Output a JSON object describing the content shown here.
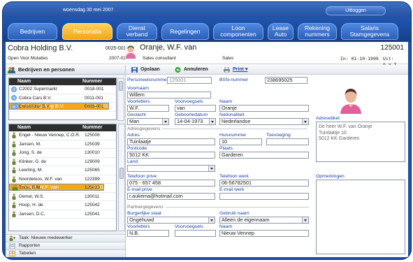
{
  "topbar": {
    "date": "woensdag 30 mei 2007",
    "logout_label": "Uitloggen"
  },
  "tabs": [
    {
      "label": "Bedrijven"
    },
    {
      "label": "Personalia"
    },
    {
      "label": "Dienst verband"
    },
    {
      "label": "Regelingen"
    },
    {
      "label": "Loon componenten"
    },
    {
      "label": "Lease Auto"
    },
    {
      "label": "Rekening nummers"
    },
    {
      "label": "Salaris Stamgegevens"
    }
  ],
  "header": {
    "company": "Cobra Holding B.V.",
    "company_code": "0025-001",
    "company_sub": "Open Voor Mutaties",
    "year": "2007-02",
    "person": "Oranje, W.F. van",
    "role": "Sales consultant",
    "department": "Sales",
    "person_code": "125001",
    "in_date": "In: 01-10-1999",
    "out_date": "Uit: n.v.t."
  },
  "left": {
    "title": "Bedrijven en personen",
    "companies_header": {
      "name": "Naam",
      "number": "Nummer"
    },
    "companies": [
      {
        "name": "C2002 Supermarkt",
        "number": "0018-001"
      },
      {
        "name": "Cobra Cars B.V.",
        "number": "0011-001"
      },
      {
        "name": "Cobra Holding B.V.",
        "number": "0025-001"
      },
      {
        "name": "Constrictor B.V.",
        "number": "0003-001"
      }
    ],
    "persons_header": {
      "name": "Naam",
      "number": "Nummer"
    },
    "persons": [
      {
        "name": "Engel - Nieuw Vennep, C.O.R.",
        "number": "125006"
      },
      {
        "name": "Jansen, M.",
        "number": "125039"
      },
      {
        "name": "Jong, S. de",
        "number": "130010"
      },
      {
        "name": "Klinker, G. de",
        "number": "129009"
      },
      {
        "name": "Leerling, M.",
        "number": "125065"
      },
      {
        "name": "Noordeloos, W.F. van",
        "number": "122399"
      },
      {
        "name": "Oranje, W.F. van",
        "number": "125001"
      },
      {
        "name": "Tsiou, B.M.",
        "number": "125023"
      },
      {
        "name": "Demel, W.S.",
        "number": "130011"
      },
      {
        "name": "Hoop, H. de",
        "number": "125042"
      },
      {
        "name": "Jansen, D.C.",
        "number": "125041"
      }
    ],
    "nav": [
      {
        "label": "Taak: Nieuwe medewerker"
      },
      {
        "label": "Rapporten"
      },
      {
        "label": "Tabellen"
      }
    ]
  },
  "toolbar": {
    "save": "Opslaan",
    "cancel": "Annuleren",
    "print": "Print ▾"
  },
  "form": {
    "personeelsnummer": {
      "label": "Personeelsnummer",
      "value": "125001"
    },
    "bsn": {
      "label": "BSN-nummer",
      "value": "238695025"
    },
    "voornaam": {
      "label": "Voornaam",
      "value": "Willem"
    },
    "voorletters": {
      "label": "Voorletters",
      "value": "W.F."
    },
    "voorvoegsels": {
      "label": "Voorvoegsels",
      "value": "van"
    },
    "naam": {
      "label": "Naam",
      "value": "Oranje"
    },
    "geslacht": {
      "label": "Geslacht",
      "value": "Man"
    },
    "geboortedatum": {
      "label": "Geboortedatum",
      "value": "14-04-1973"
    },
    "nationaliteit": {
      "label": "Nationaliteit",
      "value": "Nederlandse"
    },
    "adresetiket": {
      "label": "Adresetiket",
      "lines": [
        "De heer W.F. van Oranje",
        "Tuinlaatje 10",
        "5012 KK  Garderen"
      ]
    },
    "adres_section": "Adresgegevens",
    "adres": {
      "label": "Adres",
      "value": "Tuinlaatje"
    },
    "huisnummer": {
      "label": "Huisnummer",
      "value": "10"
    },
    "toevoeging": {
      "label": "Toevoeging",
      "value": ""
    },
    "postcode": {
      "label": "Postcode",
      "value": "5012 KK"
    },
    "plaats": {
      "label": "Plaats",
      "value": "Garderen"
    },
    "land": {
      "label": "Land",
      "value": ""
    },
    "tel_prive": {
      "label": "Telefoon prive",
      "value": "075 - 657 458"
    },
    "tel_werk": {
      "label": "Telefoon werk",
      "value": "06-56782501"
    },
    "email_prive": {
      "label": "E-mail prive",
      "value": "r.aukema@hotmail.com"
    },
    "email_werk": {
      "label": "E-mail werk",
      "value": ""
    },
    "opmerkingen": {
      "label": "Opmerkingen"
    },
    "partner_section": "Partnergegevens",
    "burgerlijke_staat": {
      "label": "Burgerlijke staat",
      "value": "Ongehuwd"
    },
    "gebruik_naam": {
      "label": "Gebruik naam",
      "value": "Alleen de eigennaam"
    },
    "p_voorletters": {
      "label": "Voorletters",
      "value": "N.B."
    },
    "p_voorvoegsels": {
      "label": "Voorvoegsels",
      "value": ""
    },
    "p_naam": {
      "label": "Naam",
      "value": "Nieuw Vennep"
    }
  },
  "colors": {
    "frame": "#1e4fa0",
    "tab": "#2a5fb9",
    "tab_active": "#f3a61b",
    "label": "#1a3ea5",
    "selection": "#f6a717"
  }
}
